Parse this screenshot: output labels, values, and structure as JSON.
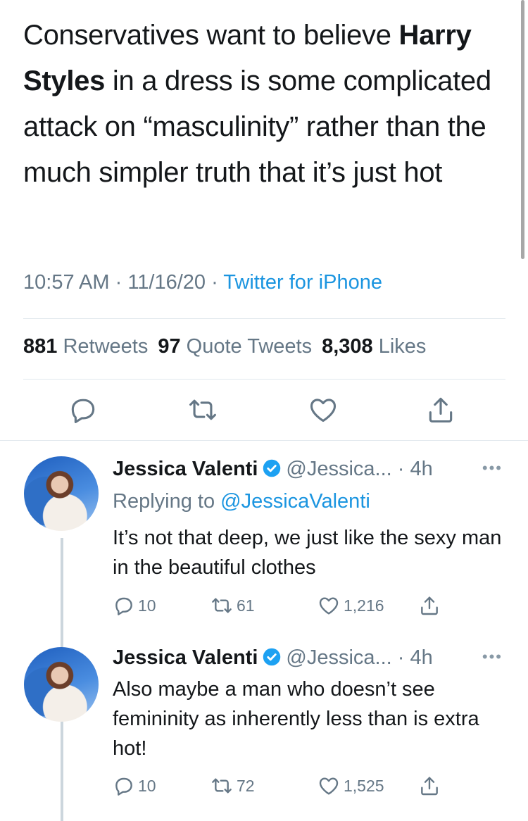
{
  "tweet": {
    "text_pre": "Conservatives want to believe ",
    "text_bold": "Harry Styles",
    "text_post": " in a dress is some complicated attack on “masculinity” rather than the much simpler truth that it’s just hot",
    "time": "10:57 AM",
    "sep1": " · ",
    "date": "11/16/20",
    "sep2": " · ",
    "source": "Twitter for iPhone",
    "retweets_count": "881",
    "retweets_label": "Retweets",
    "quotes_count": "97",
    "quotes_label": "Quote Tweets",
    "likes_count": "8,308",
    "likes_label": "Likes"
  },
  "replies": [
    {
      "name": "Jessica Valenti",
      "handle": "@Jessica...",
      "time": "· 4h",
      "more": "•••",
      "replying_prefix": "Replying to ",
      "replying_mention": "@JessicaValenti",
      "text": "It’s not that deep, we just like the sexy man in the beautiful clothes",
      "reply_count": "10",
      "retweet_count": "61",
      "like_count": "1,216"
    },
    {
      "name": "Jessica Valenti",
      "handle": "@Jessica...",
      "time": "· 4h",
      "more": "•••",
      "text": "Also maybe a man who doesn’t see femininity as inherently less than is extra hot!",
      "reply_count": "10",
      "retweet_count": "72",
      "like_count": "1,525"
    }
  ],
  "icons": {
    "reply": "reply-icon",
    "retweet": "retweet-icon",
    "like": "heart-icon",
    "share": "share-icon",
    "verified": "verified-badge-icon"
  },
  "colors": {
    "accent": "#1b95e0",
    "secondary_text": "#657786",
    "primary_text": "#14171a",
    "verified": "#1da1f2"
  }
}
